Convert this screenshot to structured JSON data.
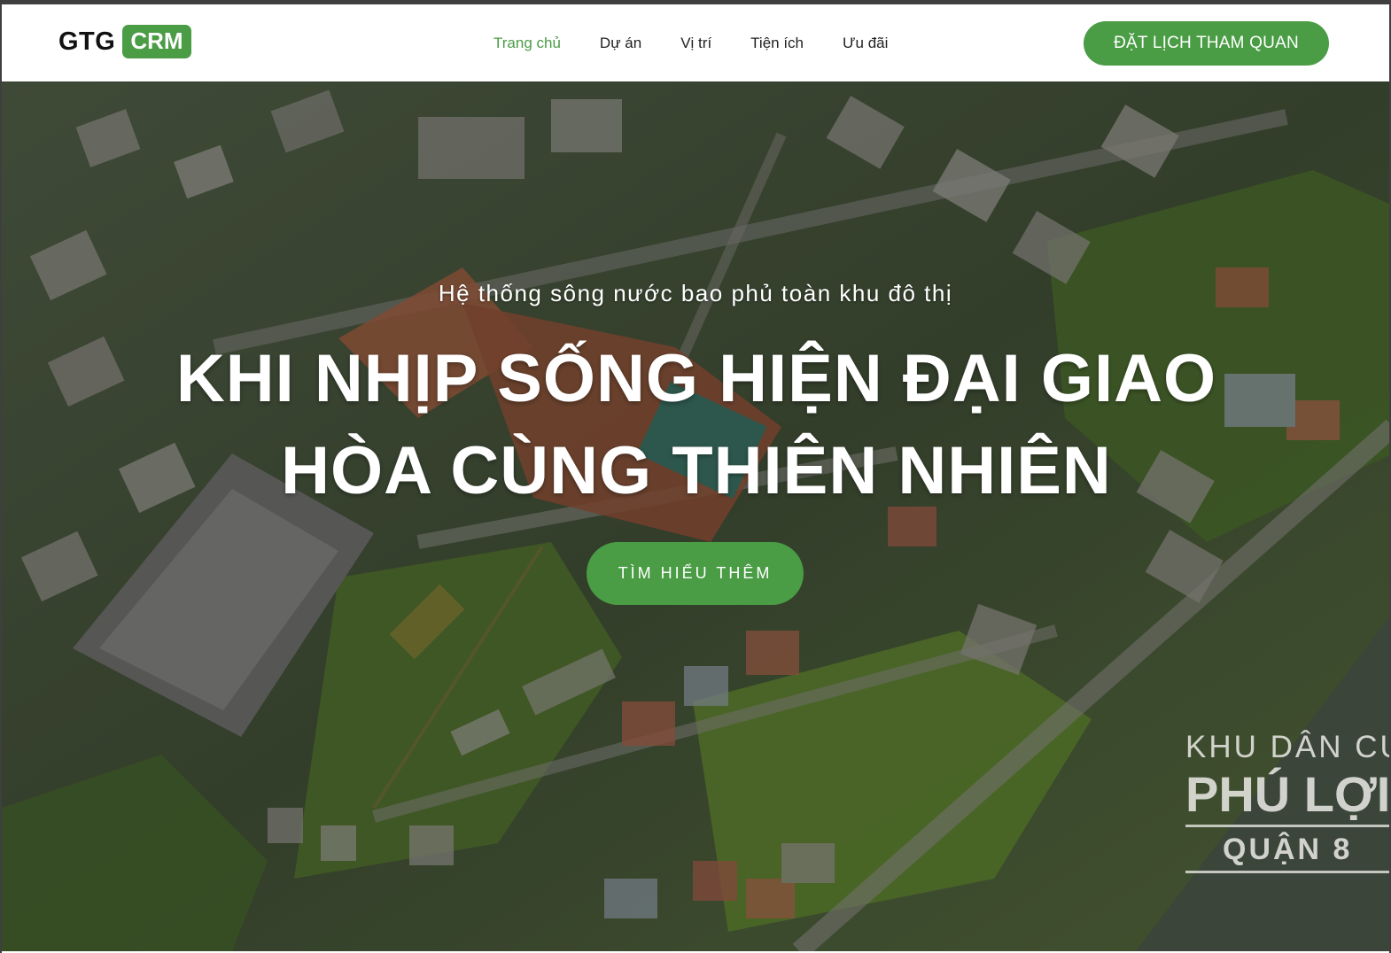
{
  "brand": {
    "logo_text": "GTG",
    "logo_badge": "CRM",
    "accent": "#4a9c45"
  },
  "nav": {
    "items": [
      {
        "label": "Trang chủ",
        "active": true
      },
      {
        "label": "Dự án"
      },
      {
        "label": "Vị trí"
      },
      {
        "label": "Tiện ích"
      },
      {
        "label": "Ưu đãi"
      }
    ],
    "cta_label": "ĐẶT LỊCH THAM QUAN"
  },
  "hero": {
    "subtitle": "Hệ thống sông nước bao phủ toàn khu đô thị",
    "title_line1": "KHI NHỊP SỐNG HIỆN ĐẠI GIAO",
    "title_line2": "HÒA CÙNG THIÊN NHIÊN",
    "button_label": "TÌM HIỂU THÊM",
    "sign": {
      "line1": "KHU DÂN CƯ",
      "line2": "PHÚ LỢI",
      "line3": "QUẬN 8"
    }
  }
}
